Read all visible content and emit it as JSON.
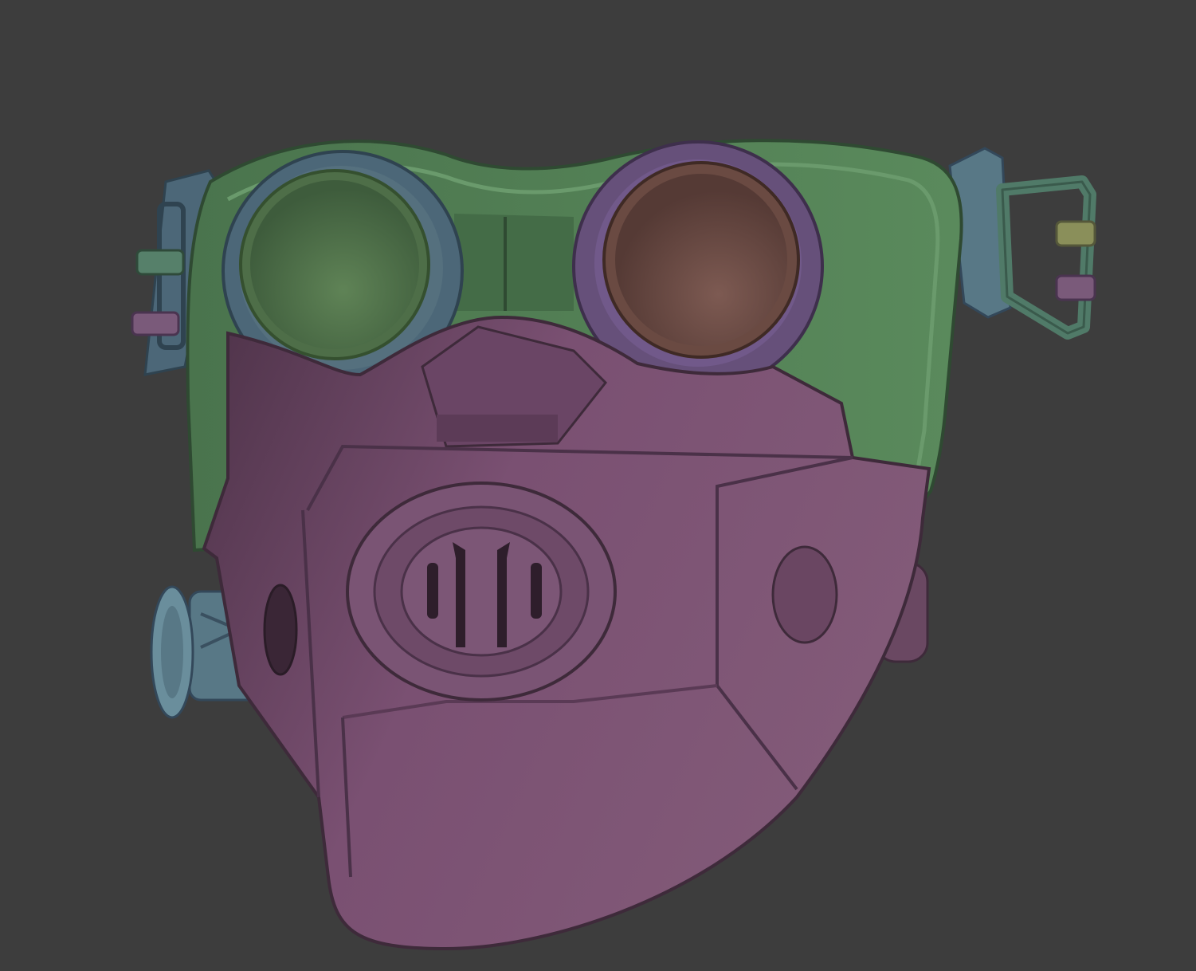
{
  "scene": {
    "background": "#3d3d3d",
    "subject": "gas-mask-3d-render",
    "materials": {
      "shell_green": "#4f7a52",
      "shell_green_light": "#6a9a6c",
      "ring_blue": "#4c6778",
      "ring_purple": "#66507a",
      "lens_green": "#4e6e48",
      "lens_brown": "#6a4a42",
      "face_purple": "#7a5070",
      "face_purple_dark": "#5a3a55",
      "strap_blue": "#56707e",
      "clip_yellow": "#8a8f5a",
      "clip_pink": "#8a5a80",
      "canister_blue": "#587886"
    }
  }
}
